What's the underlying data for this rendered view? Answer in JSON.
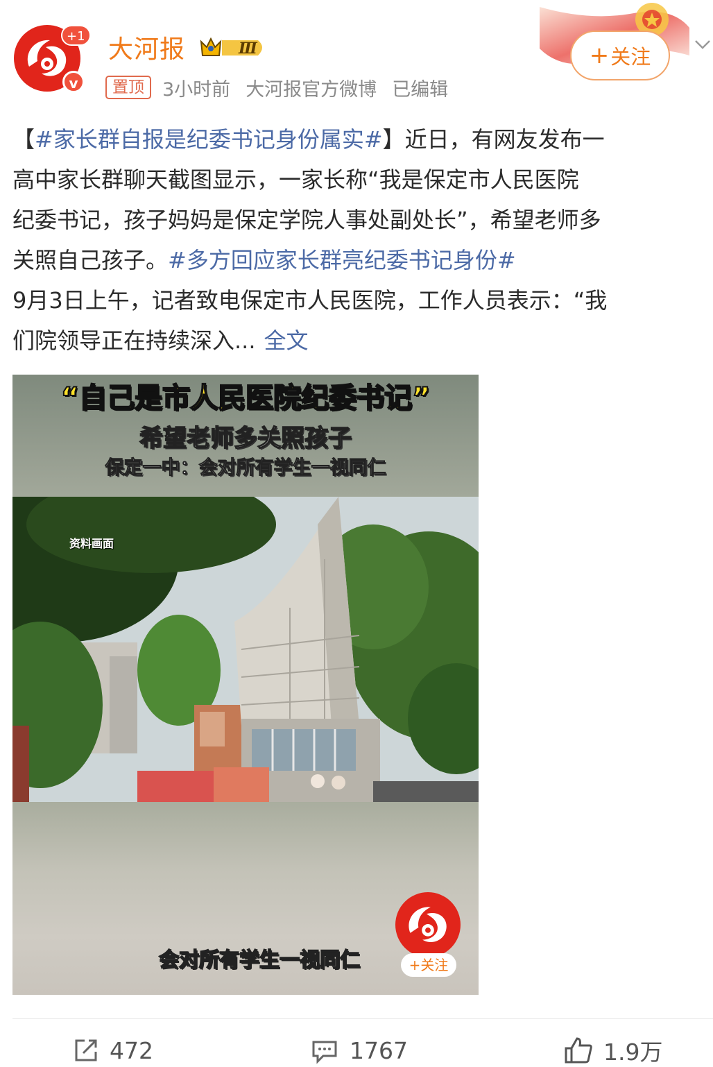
{
  "header": {
    "account_name": "大河报",
    "level": "Ⅲ",
    "new_badge": "+1",
    "verified_mark": "v",
    "pin_label": "置顶",
    "time": "3小时前",
    "source": "大河报官方微博",
    "edited": "已编辑",
    "follow_label": "关注",
    "follow_plus": "+"
  },
  "post": {
    "line1_open": "【",
    "line1_tag": "#家长群自报是纪委书记身份属实#",
    "line1_rest": "】近日，有网友发布一",
    "line2": "高中家长群聊天截图显示，一家长称“我是保定市人民医院",
    "line3": "纪委书记，孩子妈妈是保定学院人事处副处长”，希望老师多",
    "line4_text": "关照自己孩子。",
    "line4_tag": "#多方回应家长群亮纪委书记身份#",
    "line5": "9月3日上午，记者致电保定市人民医院，工作人员表示：“我",
    "line6": "们院领导正在持续深入...",
    "full_text_link": "全文"
  },
  "video": {
    "caption_main": "“自己是市人民医院纪委书记”",
    "caption_sub": "希望老师多关照孩子",
    "caption_sub2": "保定一中：会对所有学生一视同仁",
    "material_label": "资料画面",
    "subtitle": "会对所有学生一视同仁",
    "follow_label": "+关注"
  },
  "actions": {
    "repost_count": "472",
    "comment_count": "1767",
    "like_count": "1.9万"
  },
  "colors": {
    "brand_orange": "#f07a1a",
    "link_blue": "#4c6aa6",
    "logo_red": "#e1251b"
  }
}
